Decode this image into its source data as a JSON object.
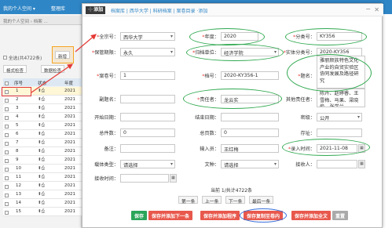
{
  "background": {
    "nav": {
      "item1": "我的个人空间 ▾",
      "item2": "整理库"
    },
    "list_tab": "我的个人空间 › 档案 ...",
    "selected_text": "全选(共4722条)",
    "new_button": "新增",
    "btn_check": "格式检查",
    "btn_data_check": "数据检查",
    "columns": {
      "seq": "序号",
      "status": "状态",
      "year": "年度"
    },
    "rows": [
      {
        "seq": "1",
        "year": "2021"
      },
      {
        "seq": "2",
        "year": "2021"
      },
      {
        "seq": "3",
        "year": "2021"
      },
      {
        "seq": "4",
        "year": "2021"
      },
      {
        "seq": "5",
        "year": "2021"
      },
      {
        "seq": "6",
        "year": "2021"
      },
      {
        "seq": "7",
        "year": "2021"
      },
      {
        "seq": "8",
        "year": "2021"
      },
      {
        "seq": "9",
        "year": "2021"
      },
      {
        "seq": "10",
        "year": "2021"
      },
      {
        "seq": "11",
        "year": "2021"
      },
      {
        "seq": "12",
        "year": "2021"
      },
      {
        "seq": "13",
        "year": "2021"
      },
      {
        "seq": "14",
        "year": "2021"
      },
      {
        "seq": "15",
        "year": "2021"
      }
    ]
  },
  "modal": {
    "add_button": "➕添加",
    "breadcrumb": "档案库 | 西华大学 | 科研档案 | 案卷目录 ·添加",
    "fields": {
      "quanzong_label": "全宗号：",
      "quanzong_value": "西华大学",
      "niandu_label": "年度：",
      "niandu_value": "2020",
      "fenleihao_label": "分类号：",
      "fenleihao_value": "KY356",
      "baoguan_label": "保管期限：",
      "baoguan_value": "永久",
      "guidan_label": "归档单位：",
      "guidan_value": "经济学院",
      "shiti_label": "实体分类号：",
      "shiti_value": "2020-KY356",
      "anjuan_label": "案卷号：",
      "anjuan_value": "1",
      "danghao_label": "档号：",
      "danghao_value": "2020-KY356-1",
      "timing_label": "题名：",
      "timing_value": "雅丽颜族特色文化产业的自贸实验区协同发展及路径研究",
      "fuming_label": "副题名：",
      "fuming_value": "",
      "zeren_label": "责任者：",
      "zeren_value": "龙云实",
      "qita_label": "其他责任者：",
      "qita_value": "陈卉、赵婷睿、王雪梅、马果、梁晓俊、张学兰",
      "kaishi_label": "开始日期：",
      "kaishi_value": "",
      "jieshu_label": "结束日期：",
      "jieshu_value": "",
      "miji_label": "密级：",
      "miji_value": "公开",
      "zongjian_label": "总件数：",
      "zongjian_value": "0",
      "zongye_label": "总页数：",
      "zongye_value": "0",
      "cunzhi_label": "存址：",
      "cunzhi_value": "",
      "beizhu_label": "备注：",
      "beizhu_value": "",
      "shuru_label": "输入员：",
      "shuru_value": "王红梅",
      "luru_label": "录入时间：",
      "luru_value": "2021-11-08",
      "zaiti_label": "载体类型：",
      "zaiti_value": "请选择",
      "wenzhong_label": "文种：",
      "wenzhong_value": "请选择",
      "jieshou_label": "接收人：",
      "jieshou_value": "",
      "jieshoutime_label": "接收时间：",
      "jieshoutime_value": ""
    },
    "pager": {
      "info": "当前 1/共计4722条",
      "first": "第一条",
      "prev": "上一条",
      "next": "下一条",
      "last": "最后一条"
    },
    "footer": {
      "save": "保存",
      "save_add_next": "保存并添加下一条",
      "save_add_prev": "保存并添加程序",
      "save_copy_to_volume": "保存复制至卷内",
      "save_add_full": "保存并添加全文",
      "reset": "重置"
    }
  }
}
